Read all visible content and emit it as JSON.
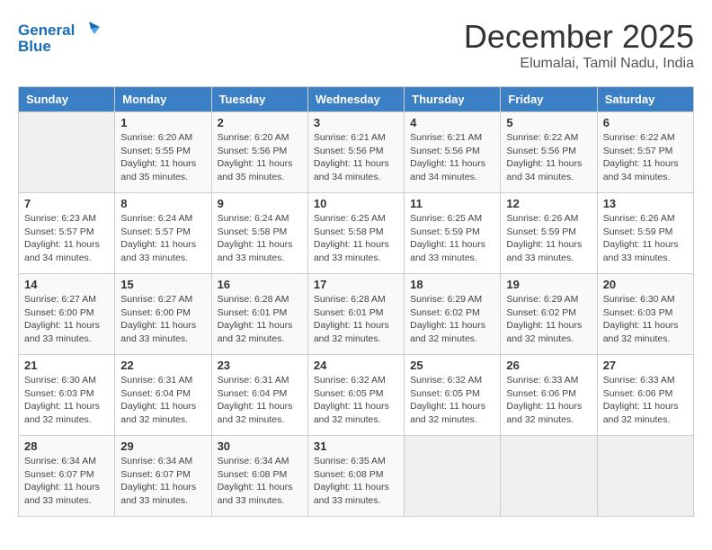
{
  "header": {
    "logo_line1": "General",
    "logo_line2": "Blue",
    "month": "December 2025",
    "location": "Elumalai, Tamil Nadu, India"
  },
  "weekdays": [
    "Sunday",
    "Monday",
    "Tuesday",
    "Wednesday",
    "Thursday",
    "Friday",
    "Saturday"
  ],
  "weeks": [
    [
      {
        "day": "",
        "sunrise": "",
        "sunset": "",
        "daylight": ""
      },
      {
        "day": "1",
        "sunrise": "Sunrise: 6:20 AM",
        "sunset": "Sunset: 5:55 PM",
        "daylight": "Daylight: 11 hours and 35 minutes."
      },
      {
        "day": "2",
        "sunrise": "Sunrise: 6:20 AM",
        "sunset": "Sunset: 5:56 PM",
        "daylight": "Daylight: 11 hours and 35 minutes."
      },
      {
        "day": "3",
        "sunrise": "Sunrise: 6:21 AM",
        "sunset": "Sunset: 5:56 PM",
        "daylight": "Daylight: 11 hours and 34 minutes."
      },
      {
        "day": "4",
        "sunrise": "Sunrise: 6:21 AM",
        "sunset": "Sunset: 5:56 PM",
        "daylight": "Daylight: 11 hours and 34 minutes."
      },
      {
        "day": "5",
        "sunrise": "Sunrise: 6:22 AM",
        "sunset": "Sunset: 5:56 PM",
        "daylight": "Daylight: 11 hours and 34 minutes."
      },
      {
        "day": "6",
        "sunrise": "Sunrise: 6:22 AM",
        "sunset": "Sunset: 5:57 PM",
        "daylight": "Daylight: 11 hours and 34 minutes."
      }
    ],
    [
      {
        "day": "7",
        "sunrise": "Sunrise: 6:23 AM",
        "sunset": "Sunset: 5:57 PM",
        "daylight": "Daylight: 11 hours and 34 minutes."
      },
      {
        "day": "8",
        "sunrise": "Sunrise: 6:24 AM",
        "sunset": "Sunset: 5:57 PM",
        "daylight": "Daylight: 11 hours and 33 minutes."
      },
      {
        "day": "9",
        "sunrise": "Sunrise: 6:24 AM",
        "sunset": "Sunset: 5:58 PM",
        "daylight": "Daylight: 11 hours and 33 minutes."
      },
      {
        "day": "10",
        "sunrise": "Sunrise: 6:25 AM",
        "sunset": "Sunset: 5:58 PM",
        "daylight": "Daylight: 11 hours and 33 minutes."
      },
      {
        "day": "11",
        "sunrise": "Sunrise: 6:25 AM",
        "sunset": "Sunset: 5:59 PM",
        "daylight": "Daylight: 11 hours and 33 minutes."
      },
      {
        "day": "12",
        "sunrise": "Sunrise: 6:26 AM",
        "sunset": "Sunset: 5:59 PM",
        "daylight": "Daylight: 11 hours and 33 minutes."
      },
      {
        "day": "13",
        "sunrise": "Sunrise: 6:26 AM",
        "sunset": "Sunset: 5:59 PM",
        "daylight": "Daylight: 11 hours and 33 minutes."
      }
    ],
    [
      {
        "day": "14",
        "sunrise": "Sunrise: 6:27 AM",
        "sunset": "Sunset: 6:00 PM",
        "daylight": "Daylight: 11 hours and 33 minutes."
      },
      {
        "day": "15",
        "sunrise": "Sunrise: 6:27 AM",
        "sunset": "Sunset: 6:00 PM",
        "daylight": "Daylight: 11 hours and 33 minutes."
      },
      {
        "day": "16",
        "sunrise": "Sunrise: 6:28 AM",
        "sunset": "Sunset: 6:01 PM",
        "daylight": "Daylight: 11 hours and 32 minutes."
      },
      {
        "day": "17",
        "sunrise": "Sunrise: 6:28 AM",
        "sunset": "Sunset: 6:01 PM",
        "daylight": "Daylight: 11 hours and 32 minutes."
      },
      {
        "day": "18",
        "sunrise": "Sunrise: 6:29 AM",
        "sunset": "Sunset: 6:02 PM",
        "daylight": "Daylight: 11 hours and 32 minutes."
      },
      {
        "day": "19",
        "sunrise": "Sunrise: 6:29 AM",
        "sunset": "Sunset: 6:02 PM",
        "daylight": "Daylight: 11 hours and 32 minutes."
      },
      {
        "day": "20",
        "sunrise": "Sunrise: 6:30 AM",
        "sunset": "Sunset: 6:03 PM",
        "daylight": "Daylight: 11 hours and 32 minutes."
      }
    ],
    [
      {
        "day": "21",
        "sunrise": "Sunrise: 6:30 AM",
        "sunset": "Sunset: 6:03 PM",
        "daylight": "Daylight: 11 hours and 32 minutes."
      },
      {
        "day": "22",
        "sunrise": "Sunrise: 6:31 AM",
        "sunset": "Sunset: 6:04 PM",
        "daylight": "Daylight: 11 hours and 32 minutes."
      },
      {
        "day": "23",
        "sunrise": "Sunrise: 6:31 AM",
        "sunset": "Sunset: 6:04 PM",
        "daylight": "Daylight: 11 hours and 32 minutes."
      },
      {
        "day": "24",
        "sunrise": "Sunrise: 6:32 AM",
        "sunset": "Sunset: 6:05 PM",
        "daylight": "Daylight: 11 hours and 32 minutes."
      },
      {
        "day": "25",
        "sunrise": "Sunrise: 6:32 AM",
        "sunset": "Sunset: 6:05 PM",
        "daylight": "Daylight: 11 hours and 32 minutes."
      },
      {
        "day": "26",
        "sunrise": "Sunrise: 6:33 AM",
        "sunset": "Sunset: 6:06 PM",
        "daylight": "Daylight: 11 hours and 32 minutes."
      },
      {
        "day": "27",
        "sunrise": "Sunrise: 6:33 AM",
        "sunset": "Sunset: 6:06 PM",
        "daylight": "Daylight: 11 hours and 32 minutes."
      }
    ],
    [
      {
        "day": "28",
        "sunrise": "Sunrise: 6:34 AM",
        "sunset": "Sunset: 6:07 PM",
        "daylight": "Daylight: 11 hours and 33 minutes."
      },
      {
        "day": "29",
        "sunrise": "Sunrise: 6:34 AM",
        "sunset": "Sunset: 6:07 PM",
        "daylight": "Daylight: 11 hours and 33 minutes."
      },
      {
        "day": "30",
        "sunrise": "Sunrise: 6:34 AM",
        "sunset": "Sunset: 6:08 PM",
        "daylight": "Daylight: 11 hours and 33 minutes."
      },
      {
        "day": "31",
        "sunrise": "Sunrise: 6:35 AM",
        "sunset": "Sunset: 6:08 PM",
        "daylight": "Daylight: 11 hours and 33 minutes."
      },
      {
        "day": "",
        "sunrise": "",
        "sunset": "",
        "daylight": ""
      },
      {
        "day": "",
        "sunrise": "",
        "sunset": "",
        "daylight": ""
      },
      {
        "day": "",
        "sunrise": "",
        "sunset": "",
        "daylight": ""
      }
    ]
  ]
}
